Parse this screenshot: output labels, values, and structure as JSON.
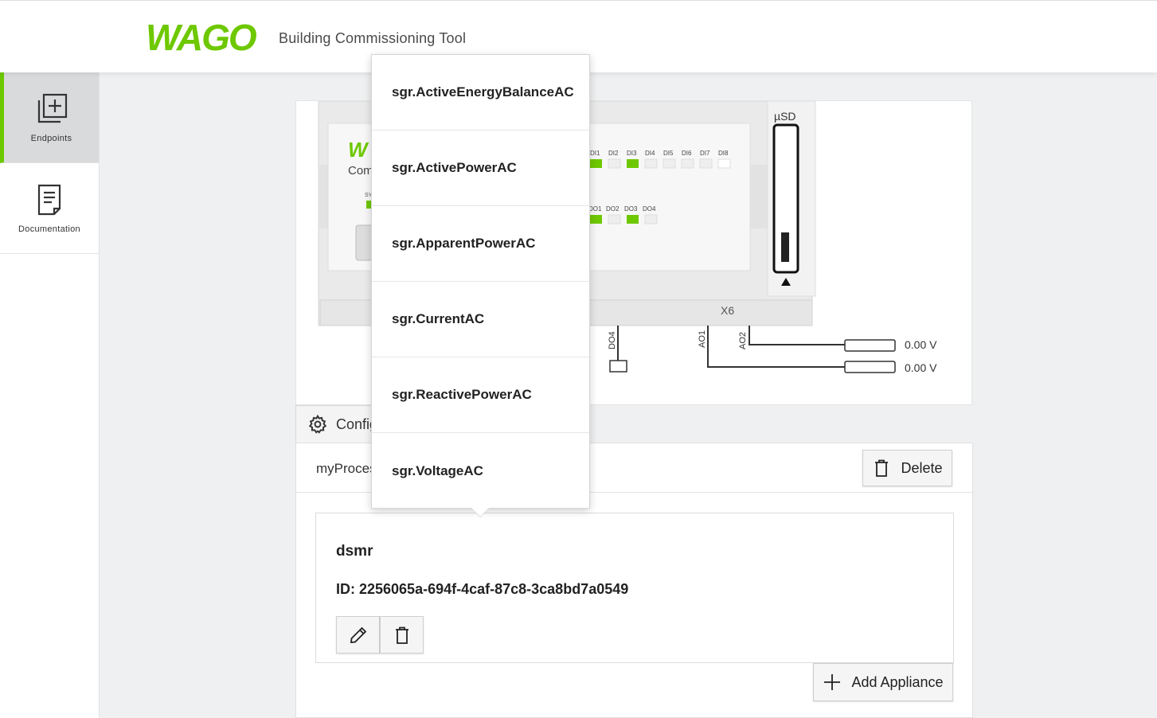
{
  "header": {
    "logo_text": "WAGO",
    "app_title": "Building Commissioning Tool"
  },
  "sidebar": {
    "items": [
      {
        "label": "Endpoints",
        "icon": "add-square-icon",
        "active": true
      },
      {
        "label": "Documentation",
        "icon": "document-icon",
        "active": false
      }
    ]
  },
  "device": {
    "sd_label": "µSD",
    "di_labels": [
      "DI1",
      "DI2",
      "DI3",
      "DI4",
      "DI5",
      "DI6",
      "DI7",
      "DI8"
    ],
    "do_labels": [
      "DO1",
      "DO2",
      "DO3",
      "DO4"
    ],
    "connector_label": "X6",
    "pin_labels": [
      "DO4",
      "AO1",
      "AO2"
    ],
    "ao_values": [
      "0.00 V",
      "0.00 V"
    ],
    "partial_text": "Com",
    "accent_color": "#6ec800"
  },
  "config_tab": {
    "label": "Config"
  },
  "process": {
    "name": "myProces",
    "delete_label": "Delete",
    "appliance": {
      "name": "dsmr",
      "id_text": "ID: 2256065a-694f-4caf-87c8-3ca8bd7a0549"
    },
    "add_label": "Add Appliance"
  },
  "dropdown": {
    "items": [
      "sgr.ActiveEnergyBalanceAC",
      "sgr.ActivePowerAC",
      "sgr.ApparentPowerAC",
      "sgr.CurrentAC",
      "sgr.ReactivePowerAC",
      "sgr.VoltageAC"
    ]
  }
}
